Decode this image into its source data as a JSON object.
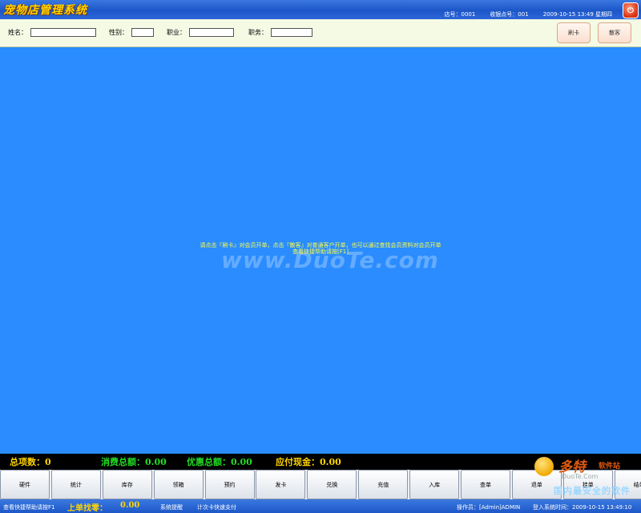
{
  "titlebar": {
    "title": "宠物店管理系统",
    "store_no": "店号：0001",
    "cashier_no": "收银点号：001",
    "datetime": "2009-10-15 13:49 星期四",
    "close_icon": "power-icon"
  },
  "search": {
    "name_label": "姓名：",
    "gender_label": "性别：",
    "job_label": "职业：",
    "title_label": "职务：",
    "name_value": "",
    "gender_value": "",
    "job_value": "",
    "title_value": "",
    "swipe_card": "刷卡",
    "walkin": "散客"
  },
  "main": {
    "line1": "请点击『刷卡』对会员开单，点击『散客』对普通客户开单，也可以通过查找会员资料对会员开单",
    "line2": "查看快捷帮助请按[F1]",
    "watermark": "www.DuoTe.com"
  },
  "totals": {
    "items_label": "总项数：",
    "items_value": "0",
    "consume_label": "消费总额：",
    "consume_value": "0.00",
    "discount_label": "优惠总额：",
    "discount_value": "0.00",
    "cash_label": "应付现金：",
    "cash_value": "0.00"
  },
  "buttons": [
    "硬件",
    "统计",
    "库存",
    "领箱",
    "预约",
    "发卡",
    "兑换",
    "充值",
    "入库",
    "查单",
    "退单",
    "挂单",
    "结单"
  ],
  "status": {
    "help": "查看快捷帮助请按F1",
    "last_change_label": "上单找零：",
    "last_change_value": "0.00",
    "sys_hint": "系统提醒",
    "card_pay": "计次卡快速支付",
    "operator": "操作员：[Admin]ADMIN",
    "login_time": "登入系统时间：2009-10-15 13:49:10"
  },
  "corner_logo": {
    "brand": "多特",
    "brand2": "软件站",
    "sub": "DuoTe.Com",
    "slogan": "国内最安全的软件站"
  }
}
